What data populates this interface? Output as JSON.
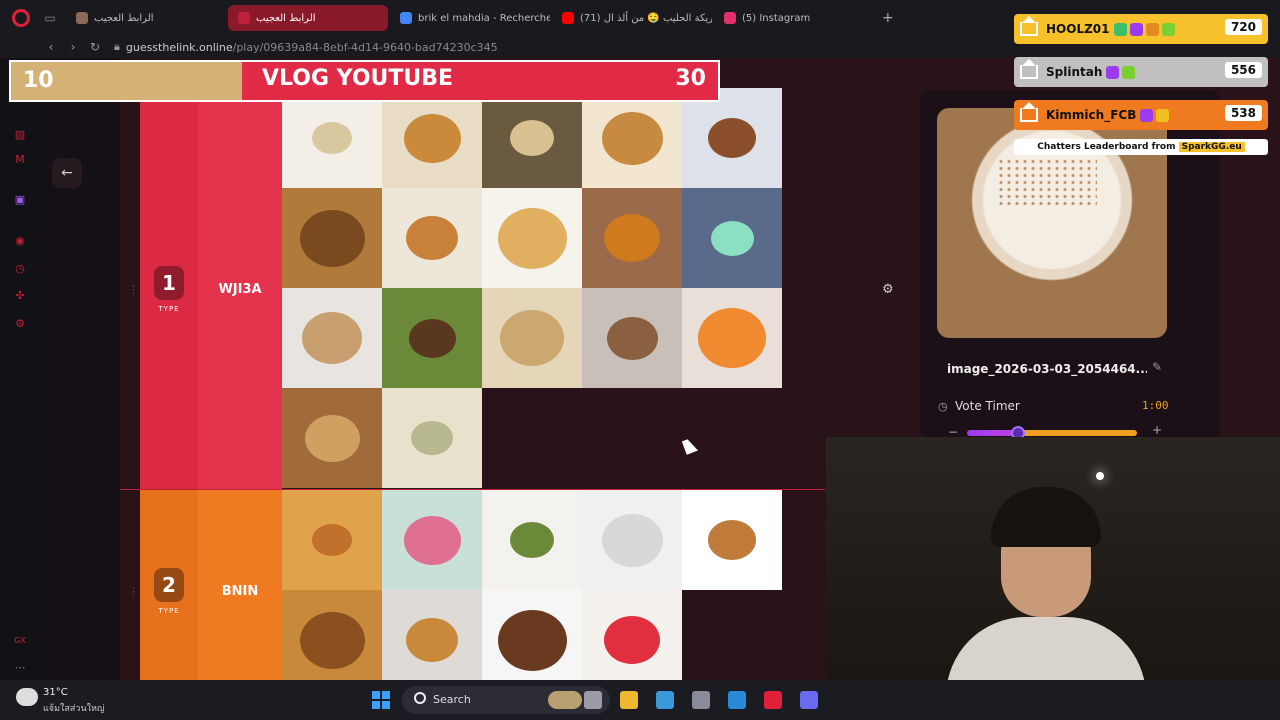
{
  "browser": {
    "tabs": [
      {
        "label": "الرابط العجيب",
        "active": false,
        "favicon_color": "#8a6a5a"
      },
      {
        "label": "الرابط العجيب",
        "active": true,
        "favicon_color": "#c0203a"
      },
      {
        "label": "brik el mahdia - Recherche",
        "active": false,
        "favicon_color": "#4285f4"
      },
      {
        "label": "(71) بريكة الحليب 🤤 من ألذ ال",
        "active": false,
        "favicon_color": "#ff0000"
      },
      {
        "label": "(5) Instagram",
        "active": false,
        "favicon_color": "#e1306c"
      }
    ],
    "url_host": "guessthelink.online",
    "url_path": "/play/09639a84-8ebf-4d14-9640-bad74230c345"
  },
  "score_overlay": {
    "left_value": "10",
    "title": "VLOG YOUTUBE",
    "right_value": "30"
  },
  "tiers": [
    {
      "number": "1",
      "type_label": "TYPE",
      "name": "WJI3A",
      "color": "#dd2a44",
      "items": [
        {
          "bg": "#f4efe6",
          "blob": "#d9c7a0"
        },
        {
          "bg": "#e9dcc4",
          "blob": "#c98a3c"
        },
        {
          "bg": "#6a5a40",
          "blob": "#d8c090"
        },
        {
          "bg": "#f2e6d0",
          "blob": "#c88a40"
        },
        {
          "bg": "#dde2ea",
          "blob": "#8a4e2a"
        },
        {
          "bg": "#b07a3a",
          "blob": "#7a4a1e"
        },
        {
          "bg": "#efe6da",
          "blob": "#c8823a"
        },
        {
          "bg": "#f6f2ec",
          "blob": "#e0b060"
        },
        {
          "bg": "#9a6a4a",
          "blob": "#d07a20"
        },
        {
          "bg": "#5a6a8a",
          "blob": "#8ae0c0"
        },
        {
          "bg": "#e8e4e0",
          "blob": "#c8a070"
        },
        {
          "bg": "#6a8a3a",
          "blob": "#5a3820"
        },
        {
          "bg": "#e6d6b8",
          "blob": "#caa870"
        },
        {
          "bg": "#c8c0b8",
          "blob": "#8a6040"
        },
        {
          "bg": "#e8e0d8",
          "blob": "#f08a30"
        },
        {
          "bg": "#a06a3a",
          "blob": "#d0a060"
        },
        {
          "bg": "#e6e2cc",
          "blob": "#b8b890"
        }
      ]
    },
    {
      "number": "2",
      "type_label": "TYPE",
      "name": "BNIN",
      "color": "#e8711e",
      "items": [
        {
          "bg": "#e0a24a",
          "blob": "#c0702a"
        },
        {
          "bg": "#c8e0d8",
          "blob": "#e07090"
        },
        {
          "bg": "#f4f2ee",
          "blob": "#6a8a3a"
        },
        {
          "bg": "#f0f0f0",
          "blob": "#d8d8d8"
        },
        {
          "bg": "#ffffff",
          "blob": "#c07a3a"
        },
        {
          "bg": "#c88a3a",
          "blob": "#8a5020"
        },
        {
          "bg": "#dedad6",
          "blob": "#c88a3a"
        },
        {
          "bg": "#f6f6f6",
          "blob": "#6a3a20"
        },
        {
          "bg": "#f4f0ec",
          "blob": "#e03040"
        }
      ]
    }
  ],
  "right_panel": {
    "image_name": "image_2026-03-03_2054464...",
    "vote_timer_label": "Vote Timer",
    "vote_timer_value": "1:00",
    "slider_level_percent": 30
  },
  "leaderboard": {
    "rows": [
      {
        "name": "HOOLZ01",
        "score": "720",
        "color": "#f6c12a",
        "badges": [
          "#3ac06a",
          "#9b3cf0",
          "#e08a20",
          "#7ad030"
        ]
      },
      {
        "name": "Splintah",
        "score": "556",
        "color": "#c0c0c0",
        "badges": [
          "#9b3cf0",
          "#7ad030"
        ]
      },
      {
        "name": "Kimmich_FCB",
        "score": "538",
        "color": "#f07a20",
        "badges": [
          "#9b3cf0",
          "#f0c020"
        ]
      }
    ],
    "footer_text": "Chatters Leaderboard from",
    "footer_brand": "SparkGG.eu"
  },
  "taskbar": {
    "temp": "31°C",
    "weather_desc": "แจ้มใสส่วนใหญ่",
    "search_label": "Search",
    "apps": [
      "#b8a070",
      "#9a9aa8",
      "#f0b830",
      "#3a9ad8",
      "#8a8a9a",
      "#2a8ad8",
      "#e0203a",
      "#6a6af0"
    ]
  }
}
